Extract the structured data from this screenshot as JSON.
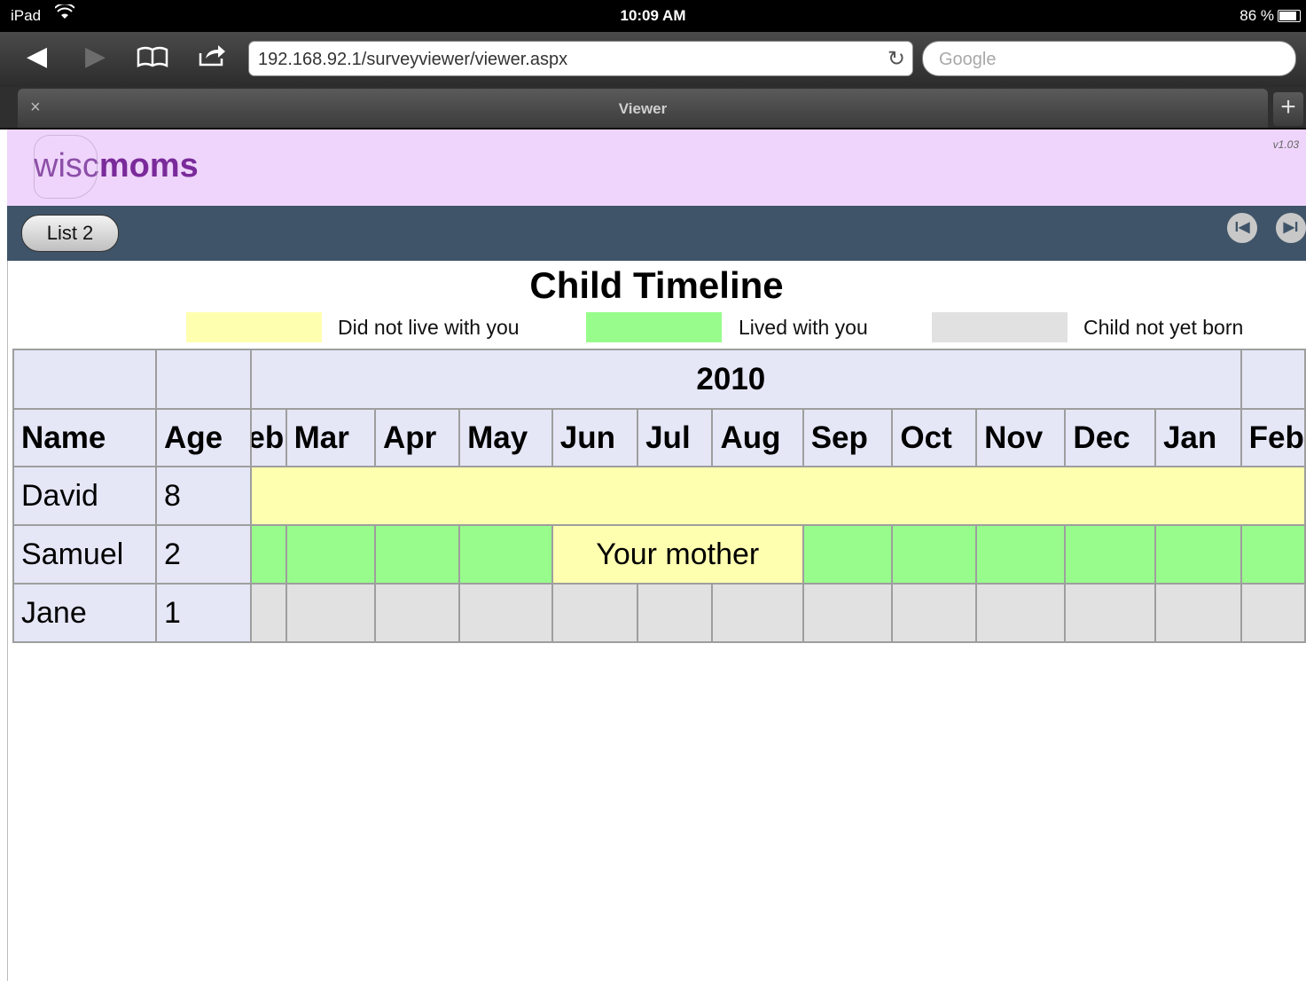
{
  "status_bar": {
    "carrier": "iPad",
    "time": "10:09 AM",
    "battery": "86 %"
  },
  "browser": {
    "url": "192.168.92.1/surveyviewer/viewer.aspx",
    "search_placeholder": "Google",
    "tab_title": "Viewer",
    "close_glyph": "×",
    "new_tab_glyph": "+"
  },
  "site": {
    "logo_wisc": "wisc",
    "logo_moms": "moms",
    "version": "v1.03"
  },
  "nav": {
    "list_button": "List 2"
  },
  "page": {
    "title": "Child Timeline"
  },
  "legend": [
    {
      "label": "Did not live with you",
      "color": "#ffffb0"
    },
    {
      "label": "Lived with you",
      "color": "#98fc8c"
    },
    {
      "label": "Child not yet born",
      "color": "#e1e1e1"
    }
  ],
  "table": {
    "headers": {
      "name": "Name",
      "age": "Age"
    },
    "year": "2010",
    "months": [
      "Feb",
      "Mar",
      "Apr",
      "May",
      "Jun",
      "Jul",
      "Aug",
      "Sep",
      "Oct",
      "Nov",
      "Dec",
      "Jan",
      "Feb"
    ],
    "rows": [
      {
        "name": "David",
        "age": "8",
        "status": "did-not-live-with-you"
      },
      {
        "name": "Samuel",
        "age": "2",
        "status": "lived-with-you",
        "note": "Your mother",
        "note_months": [
          "Jun",
          "Jul",
          "Aug"
        ]
      },
      {
        "name": "Jane",
        "age": "1",
        "status": "child-not-yet-born"
      }
    ]
  },
  "colors": {
    "nav_bar": "#3f5468",
    "header_bg": "#efd5fb",
    "logo_purple": "#7a2a9a",
    "table_header": "#e5e7f7"
  }
}
